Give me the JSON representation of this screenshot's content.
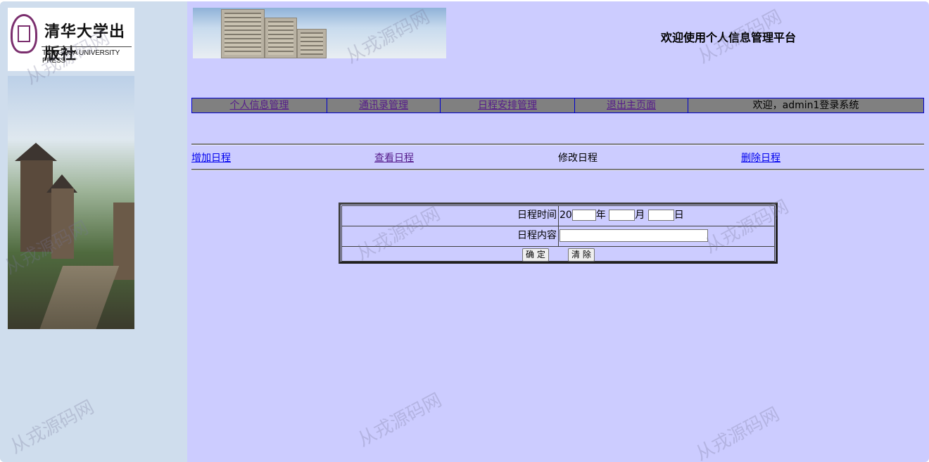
{
  "sidebar": {
    "logo": {
      "cn_name": "清华大学出版社",
      "en_name": "TSINGHUA UNIVERSITY PRESS"
    }
  },
  "header": {
    "welcome_title": "欢迎使用个人信息管理平台"
  },
  "nav": {
    "items": [
      {
        "label": "个人信息管理"
      },
      {
        "label": "通讯录管理"
      },
      {
        "label": "日程安排管理"
      },
      {
        "label": "退出主页面"
      }
    ],
    "user_greeting": "欢迎，admin1登录系统"
  },
  "subnav": {
    "items": [
      {
        "label": "增加日程"
      },
      {
        "label": "查看日程"
      },
      {
        "label": "修改日程"
      },
      {
        "label": "删除日程"
      }
    ]
  },
  "form": {
    "time_label": "日程时间",
    "year_prefix": "20",
    "year_value": "",
    "year_suffix": "年",
    "month_value": "",
    "month_suffix": "月",
    "day_value": "",
    "day_suffix": "日",
    "content_label": "日程内容",
    "content_value": "",
    "confirm_label": "确 定",
    "clear_label": "清 除"
  },
  "watermark": {
    "text": "从戎源码网"
  },
  "colors": {
    "sidebar_bg": "#cfdded",
    "main_bg": "#ccccff",
    "nav_bg": "#808080",
    "nav_border": "#0000cc"
  }
}
